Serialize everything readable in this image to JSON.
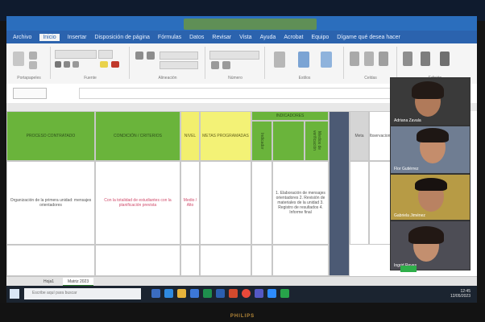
{
  "menubar": {
    "items": [
      "Archivo",
      "Inicio",
      "Insertar",
      "Disposición de página",
      "Fórmulas",
      "Datos",
      "Revisar",
      "Vista",
      "Ayuda",
      "Acrobat",
      "Equipo",
      "Dígame qué desea hacer"
    ]
  },
  "ribbon": {
    "groups": [
      "Portapapeles",
      "Fuente",
      "Alineación",
      "Número",
      "Estilos",
      "Celdas",
      "Edición"
    ]
  },
  "sheet": {
    "headers": {
      "col_a": "PROCESO CONTRATADO",
      "col_b": "CONDICIÓN / CRITERIOS",
      "col_c": "NIVEL",
      "col_d": "METAS PROGRAMADAS",
      "col_e": "INDICADORES",
      "col_e1": "Indicador",
      "col_e2": "Medios de verificación",
      "col_g": "Meta",
      "col_h": "Observaciones"
    },
    "row1": {
      "col_a": "Organización de la primera unidad: mensajes orientadores",
      "col_b": "Con la totalidad de estudiantes con la planificación prevista",
      "col_c": "Medio / Alto",
      "col_e": "1. Elaboración de mensajes orientadores  2. Revisión de materiales de la unidad  3. Registro de resultados  4. Informe final"
    }
  },
  "tabs": {
    "sheet1": "Hoja1",
    "sheet2": "Matriz 2023"
  },
  "taskbar": {
    "search_placeholder": "Escribe aquí para buscar",
    "time": "12:45",
    "date": "12/05/2023"
  },
  "video": {
    "participants": [
      {
        "name": "Adriana Zavala"
      },
      {
        "name": "Flor Gutiérrez"
      },
      {
        "name": "Gabriela Jiménez"
      },
      {
        "name": "Ingrid Reyes"
      }
    ]
  },
  "brand": "PHILIPS"
}
